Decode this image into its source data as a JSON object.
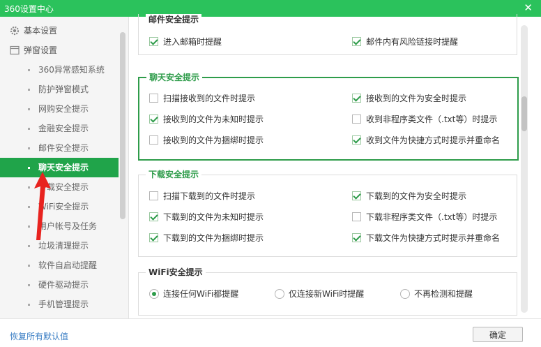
{
  "window": {
    "title": "360设置中心",
    "close_glyph": "✕"
  },
  "sidebar": {
    "top_items": [
      {
        "label": "基本设置",
        "icon": "gear-icon"
      },
      {
        "label": "弹窗设置",
        "icon": "window-icon"
      }
    ],
    "sub_items": [
      {
        "label": "360异常感知系统"
      },
      {
        "label": "防护弹窗模式"
      },
      {
        "label": "网购安全提示"
      },
      {
        "label": "金融安全提示"
      },
      {
        "label": "邮件安全提示"
      },
      {
        "label": "聊天安全提示",
        "active": true
      },
      {
        "label": "下载安全提示"
      },
      {
        "label": "WiFi安全提示"
      },
      {
        "label": "用户帐号及任务"
      },
      {
        "label": "垃圾清理提示"
      },
      {
        "label": "软件自启动提醒"
      },
      {
        "label": "硬件驱动提示"
      },
      {
        "label": "手机管理提示"
      }
    ]
  },
  "sections": {
    "mail": {
      "title": "邮件安全提示",
      "options": [
        {
          "label": "进入邮箱时提醒",
          "checked": true
        },
        {
          "label": "邮件内有风险链接时提醒",
          "checked": true
        }
      ]
    },
    "chat": {
      "title": "聊天安全提示",
      "options": [
        {
          "label": "扫描接收到的文件时提示",
          "checked": false
        },
        {
          "label": "接收到的文件为安全时提示",
          "checked": true
        },
        {
          "label": "接收到的文件为未知时提示",
          "checked": true
        },
        {
          "label": "收到非程序类文件（.txt等）时提示",
          "checked": false
        },
        {
          "label": "接收到的文件为捆绑时提示",
          "checked": false
        },
        {
          "label": "收到文件为快捷方式时提示并重命名",
          "checked": true
        }
      ]
    },
    "download": {
      "title": "下载安全提示",
      "options": [
        {
          "label": "扫描下载到的文件时提示",
          "checked": false
        },
        {
          "label": "下载到的文件为安全时提示",
          "checked": true
        },
        {
          "label": "下载到的文件为未知时提示",
          "checked": true
        },
        {
          "label": "下载非程序类文件（.txt等）时提示",
          "checked": false
        },
        {
          "label": "下载到的文件为捆绑时提示",
          "checked": true
        },
        {
          "label": "下载文件为快捷方式时提示并重命名",
          "checked": true
        }
      ]
    },
    "wifi": {
      "title": "WiFi安全提示",
      "options": [
        {
          "label": "连接任何WiFi都提醒",
          "selected": true
        },
        {
          "label": "仅连接新WiFi时提醒",
          "selected": false
        },
        {
          "label": "不再检测和提醒",
          "selected": false
        }
      ]
    }
  },
  "footer": {
    "restore_label": "恢复所有默认值",
    "ok_label": "确定"
  },
  "colors": {
    "brand_green": "#2bc25c",
    "accent_green": "#2e9c4a",
    "active_bg": "#20a44a",
    "link_blue": "#3a7ec4",
    "arrow_red": "#e8231f"
  }
}
